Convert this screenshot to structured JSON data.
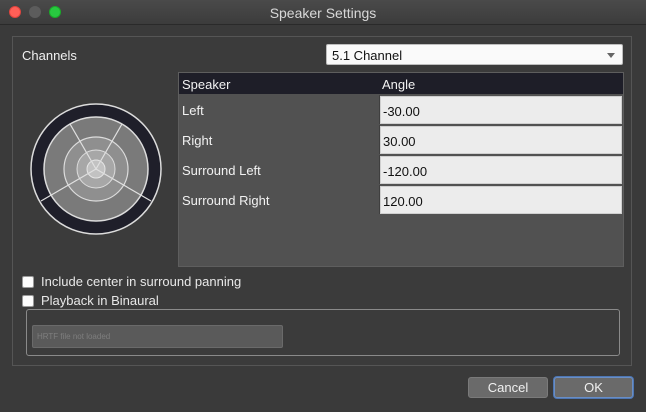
{
  "window": {
    "title": "Speaker Settings"
  },
  "channels": {
    "label": "Channels",
    "selected": "5.1 Channel"
  },
  "table": {
    "columns": [
      "Speaker",
      "Angle"
    ],
    "rows": [
      {
        "speaker": "Left",
        "angle": "-30.00"
      },
      {
        "speaker": "Right",
        "angle": "30.00"
      },
      {
        "speaker": "Surround Left",
        "angle": "-120.00"
      },
      {
        "speaker": "Surround Right",
        "angle": "120.00"
      }
    ]
  },
  "options": {
    "include_center": "Include center in surround panning",
    "binaural": "Playback in Binaural",
    "binaural_field_text": "HRTF file not loaded"
  },
  "buttons": {
    "cancel": "Cancel",
    "ok": "OK"
  },
  "icons": {
    "dropdown": "chevron-down-icon",
    "speaker_layout": "speaker-layout-icon"
  },
  "colors": {
    "accent": "#4d76b3",
    "close": "#ff5f57",
    "maximize": "#28c840"
  }
}
